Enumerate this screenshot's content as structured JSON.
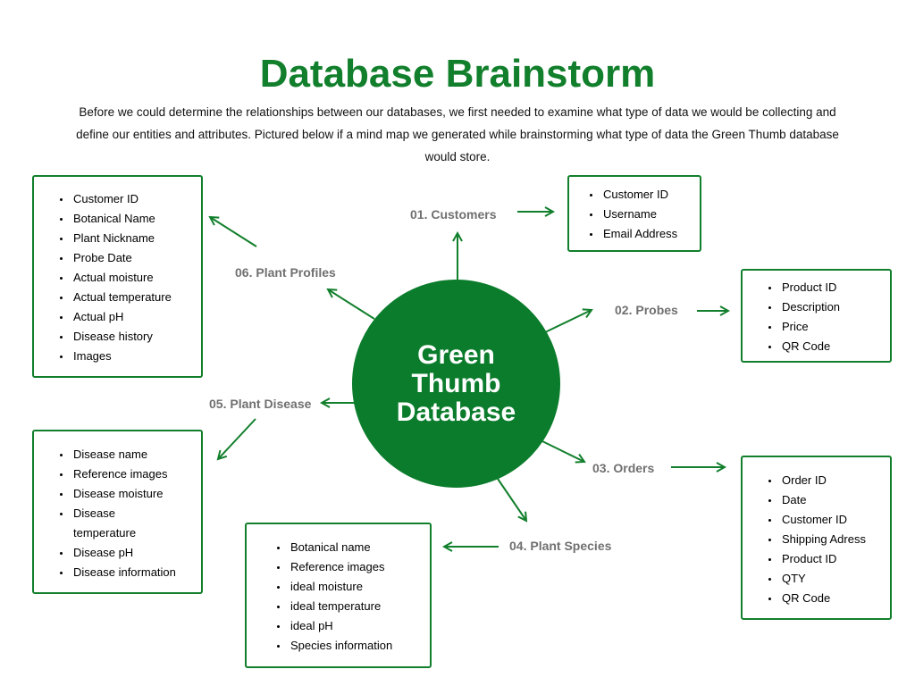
{
  "title": "Database Brainstorm",
  "intro": "Before we could determine the relationships between our databases, we first needed to examine what type of data we would be collecting and define our entities and attributes. Pictured below if a mind map we generated while brainstorming what type of data the Green Thumb database would store.",
  "center": {
    "label": "Green Thumb Database"
  },
  "accent_color": "#127f2c",
  "nodes": {
    "customers": {
      "label": "01.  Customers",
      "attributes": [
        "Customer ID",
        "Username",
        "Email Address"
      ]
    },
    "probes": {
      "label": "02. Probes",
      "attributes": [
        "Product ID",
        "Description",
        "Price",
        "QR Code"
      ]
    },
    "orders": {
      "label": "03. Orders",
      "attributes": [
        "Order ID",
        "Date",
        "Customer ID",
        "Shipping Adress",
        "Product ID",
        "QTY",
        "QR Code"
      ]
    },
    "plant_species": {
      "label": "04. Plant Species",
      "attributes": [
        "Botanical name",
        "Reference images",
        "ideal moisture",
        "ideal temperature",
        "ideal pH",
        "Species information"
      ]
    },
    "plant_disease": {
      "label": "05. Plant Disease",
      "attributes": [
        "Disease name",
        "Reference images",
        "Disease moisture",
        "Disease temperature",
        "Disease pH",
        "Disease information"
      ]
    },
    "plant_profiles": {
      "label": "06. Plant Profiles",
      "attributes": [
        "Customer ID",
        "Botanical Name",
        "Plant Nickname",
        "Probe Date",
        "Actual moisture",
        "Actual temperature",
        "Actual pH",
        "Disease history",
        "Images"
      ]
    }
  }
}
